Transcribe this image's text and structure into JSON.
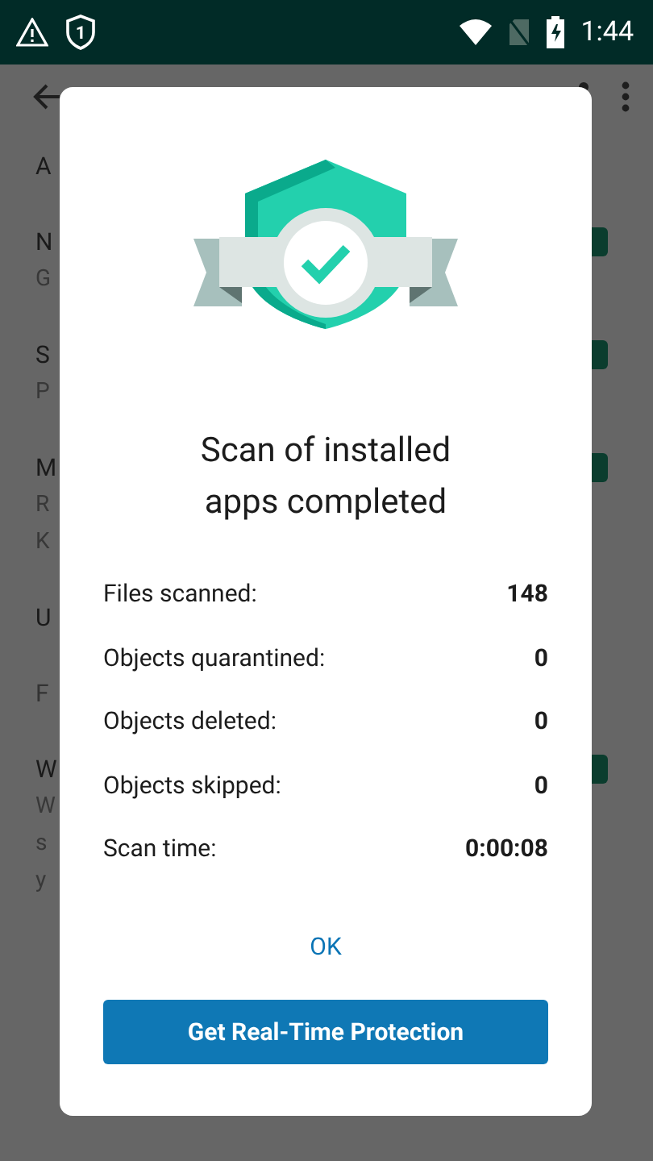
{
  "status_bar": {
    "time": "1:44",
    "notification_count": "1"
  },
  "settings": [
    {
      "title": "A"
    },
    {
      "title": "N",
      "subtitle": [
        "G"
      ],
      "checked": true
    },
    {
      "title": "S",
      "subtitle": [
        "P"
      ],
      "checked": true
    },
    {
      "title": "M",
      "subtitle": [
        "R",
        "K"
      ],
      "checked": true
    },
    {
      "title": "U"
    },
    {
      "title": "F",
      "kind": "muted"
    },
    {
      "title": "W",
      "subtitle": [
        "W",
        "s",
        "y"
      ],
      "checked": true
    }
  ],
  "dialog": {
    "title": "Scan of installed apps completed",
    "stats": [
      {
        "label": "Files scanned:",
        "value": "148"
      },
      {
        "label": "Objects quarantined:",
        "value": "0"
      },
      {
        "label": "Objects deleted:",
        "value": "0"
      },
      {
        "label": "Objects skipped:",
        "value": "0"
      },
      {
        "label": "Scan time:",
        "value": "0:00:08"
      }
    ],
    "ok_button": "OK",
    "primary_button": "Get Real-Time Protection"
  }
}
